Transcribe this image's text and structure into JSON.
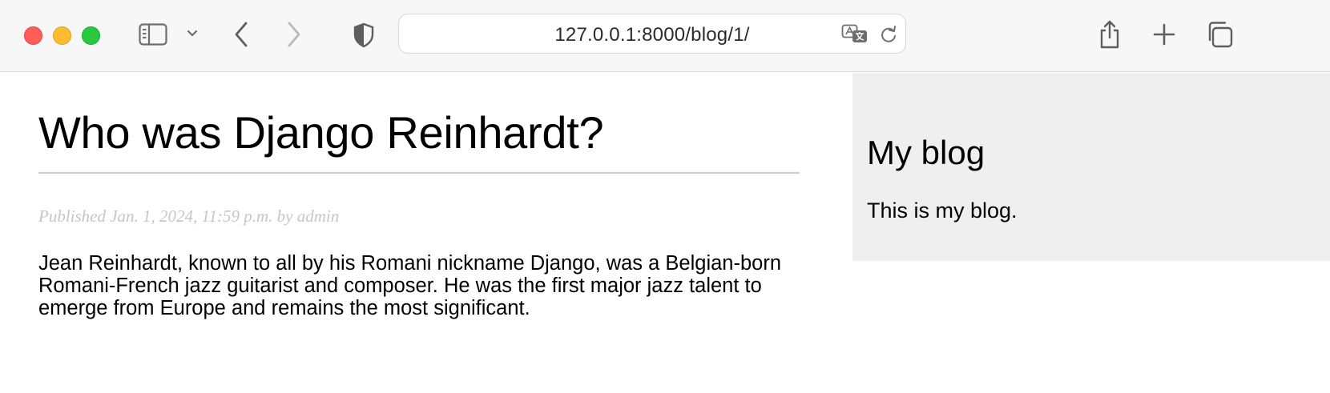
{
  "browser": {
    "address": "127.0.0.1:8000/blog/1/",
    "icons": {
      "sidebar": "sidebar-icon",
      "tab_overview_menu": "chevron-down-icon",
      "back": "back-icon",
      "forward": "forward-icon",
      "privacy": "shield-icon",
      "translate": "translate-icon",
      "reload": "reload-icon",
      "share": "share-icon",
      "new_tab": "plus-icon",
      "tabs": "tabs-icon"
    }
  },
  "post": {
    "title": "Who was Django Reinhardt?",
    "meta": "Published Jan. 1, 2024, 11:59 p.m. by admin",
    "body": "Jean Reinhardt, known to all by his Romani nickname Django, was a Belgian-born Romani-French jazz guitarist and composer. He was the first major jazz talent to emerge from Europe and remains the most significant."
  },
  "sidebar": {
    "title": "My blog",
    "text": "This is my blog."
  },
  "colors": {
    "close": "#ff5f57",
    "minimize": "#febc2e",
    "zoom": "#28c840",
    "sidebar_bg": "#efefef",
    "meta_text": "#c6c6c6"
  }
}
